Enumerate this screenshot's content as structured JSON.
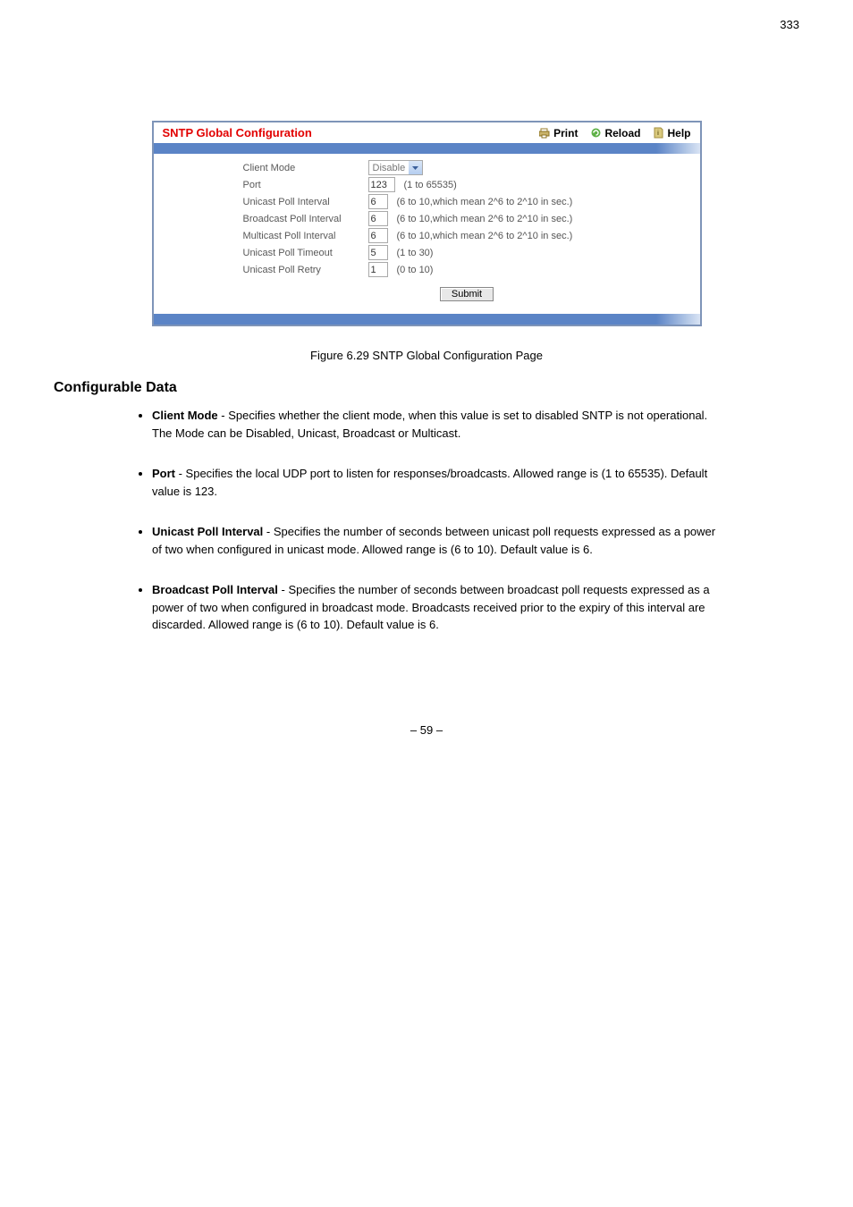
{
  "pageTopNum": "333",
  "panel": {
    "title": "SNTP Global Configuration",
    "actions": {
      "print": "Print",
      "reload": "Reload",
      "help": "Help"
    }
  },
  "form": {
    "clientMode": {
      "label": "Client Mode",
      "value": "Disable"
    },
    "port": {
      "label": "Port",
      "value": "123",
      "hint": "(1 to 65535)"
    },
    "unicastInterval": {
      "label": "Unicast Poll Interval",
      "value": "6",
      "hint": "(6 to 10,which mean 2^6 to 2^10 in sec.)"
    },
    "broadcastInterval": {
      "label": "Broadcast Poll Interval",
      "value": "6",
      "hint": "(6 to 10,which mean 2^6 to 2^10 in sec.)"
    },
    "multicastInterval": {
      "label": "Multicast Poll Interval",
      "value": "6",
      "hint": "(6 to 10,which mean 2^6 to 2^10 in sec.)"
    },
    "unicastTimeout": {
      "label": "Unicast Poll Timeout",
      "value": "5",
      "hint": "(1 to 30)"
    },
    "unicastRetry": {
      "label": "Unicast Poll Retry",
      "value": "1",
      "hint": "(0 to 10)"
    },
    "submit": "Submit"
  },
  "figureCaption": "Figure 6.29 SNTP Global Configuration Page",
  "configurable": {
    "heading": "Configurable Data",
    "items": [
      {
        "title": "Client Mode",
        "body": " - Specifies whether the client mode, when this value is set to disabled SNTP is not operational. The Mode can be Disabled, Unicast, Broadcast or Multicast."
      },
      {
        "title": "Port",
        "body": " - Specifies the local UDP port to listen for responses/broadcasts. Allowed range is (1 to 65535). Default value is 123."
      },
      {
        "title": "Unicast Poll Interval",
        "body": " - Specifies the number of seconds between unicast poll requests expressed as a power of two when configured in unicast mode. Allowed range is (6 to 10). Default value is 6."
      },
      {
        "title": "Broadcast Poll Interval",
        "body": " - Specifies the number of seconds between broadcast poll requests expressed as a power of two when configured in broadcast mode. Broadcasts received prior to the expiry of this interval are discarded. Allowed range is (6 to 10). Default value is 6."
      }
    ]
  },
  "footerPage": "– 59 –"
}
